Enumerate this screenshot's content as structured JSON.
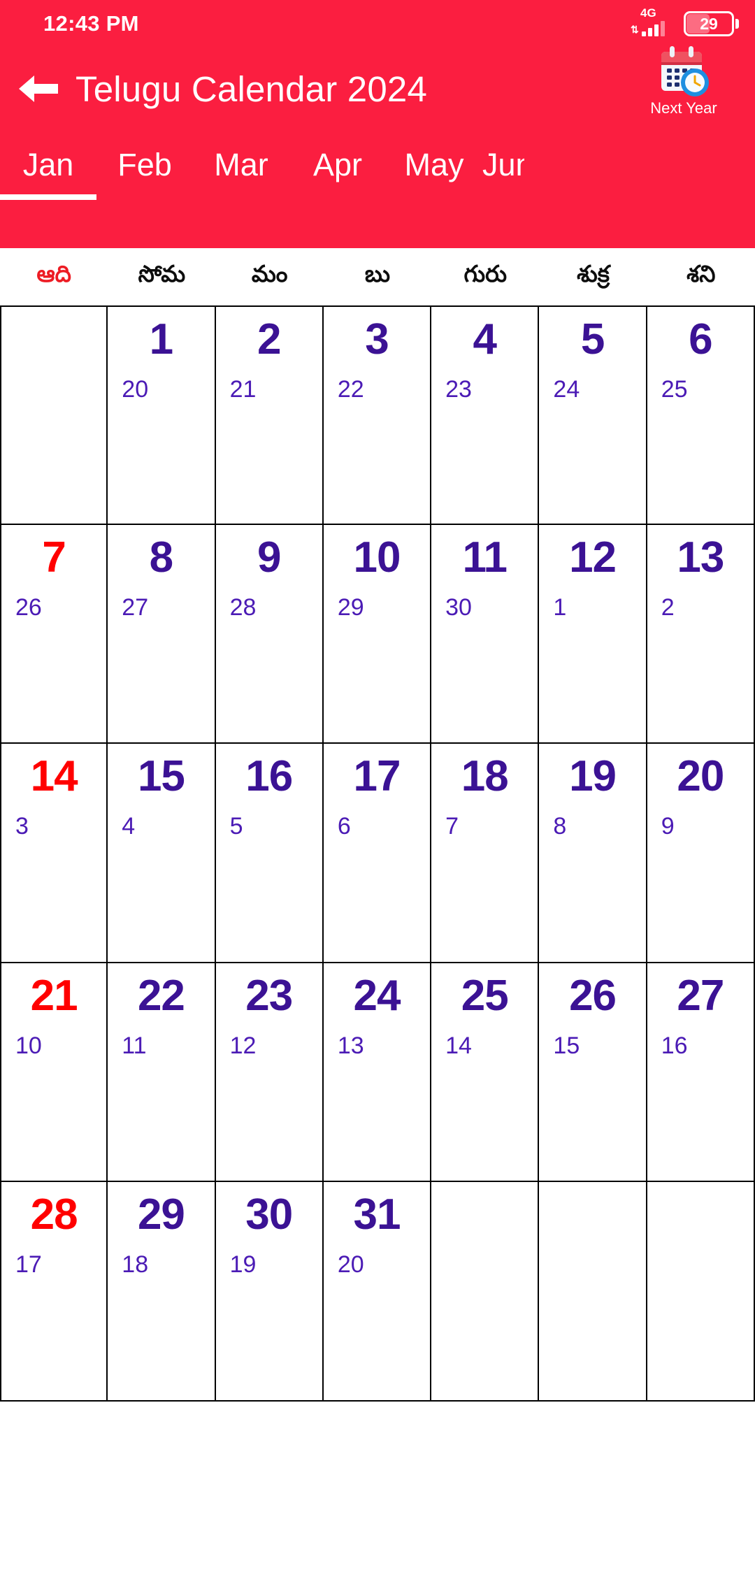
{
  "statusbar": {
    "time": "12:43 PM",
    "network_type": "4G",
    "battery_percent": "29",
    "signal_icon": "signal-bars-icon",
    "data_arrows_icon": "data-transfer-icon",
    "battery_icon": "battery-icon"
  },
  "appbar": {
    "back_icon": "back-arrow-icon",
    "title": "Telugu Calendar 2024",
    "next_year_label": "Next Year",
    "next_year_icon": "calendar-clock-icon",
    "background_color": "#FB1E40"
  },
  "tabs": {
    "selected_index": 0,
    "items": [
      {
        "label": "Jan"
      },
      {
        "label": "Feb"
      },
      {
        "label": "Mar"
      },
      {
        "label": "Apr"
      },
      {
        "label": "May"
      },
      {
        "label": "Jun"
      }
    ]
  },
  "weekdays": [
    {
      "label": "ఆది",
      "is_sunday": true
    },
    {
      "label": "సోమ",
      "is_sunday": false
    },
    {
      "label": "మం",
      "is_sunday": false
    },
    {
      "label": "బు",
      "is_sunday": false
    },
    {
      "label": "గురు",
      "is_sunday": false
    },
    {
      "label": "శుక్ర",
      "is_sunday": false
    },
    {
      "label": "శని",
      "is_sunday": false
    }
  ],
  "calendar": {
    "accent_color": "#FB1E40",
    "day_color": "#3B1294",
    "sunday_color": "#FF0000",
    "sub_color": "#4B1BB5",
    "weeks": [
      [
        {
          "day": "",
          "sub": "",
          "empty": true
        },
        {
          "day": "1",
          "sub": "20",
          "empty": false
        },
        {
          "day": "2",
          "sub": "21",
          "empty": false
        },
        {
          "day": "3",
          "sub": "22",
          "empty": false
        },
        {
          "day": "4",
          "sub": "23",
          "empty": false
        },
        {
          "day": "5",
          "sub": "24",
          "empty": false
        },
        {
          "day": "6",
          "sub": "25",
          "empty": false
        }
      ],
      [
        {
          "day": "7",
          "sub": "26",
          "empty": false
        },
        {
          "day": "8",
          "sub": "27",
          "empty": false
        },
        {
          "day": "9",
          "sub": "28",
          "empty": false
        },
        {
          "day": "10",
          "sub": "29",
          "empty": false
        },
        {
          "day": "11",
          "sub": "30",
          "empty": false
        },
        {
          "day": "12",
          "sub": "1",
          "empty": false
        },
        {
          "day": "13",
          "sub": "2",
          "empty": false
        }
      ],
      [
        {
          "day": "14",
          "sub": "3",
          "empty": false
        },
        {
          "day": "15",
          "sub": "4",
          "empty": false
        },
        {
          "day": "16",
          "sub": "5",
          "empty": false
        },
        {
          "day": "17",
          "sub": "6",
          "empty": false
        },
        {
          "day": "18",
          "sub": "7",
          "empty": false
        },
        {
          "day": "19",
          "sub": "8",
          "empty": false
        },
        {
          "day": "20",
          "sub": "9",
          "empty": false
        }
      ],
      [
        {
          "day": "21",
          "sub": "10",
          "empty": false
        },
        {
          "day": "22",
          "sub": "11",
          "empty": false
        },
        {
          "day": "23",
          "sub": "12",
          "empty": false
        },
        {
          "day": "24",
          "sub": "13",
          "empty": false
        },
        {
          "day": "25",
          "sub": "14",
          "empty": false
        },
        {
          "day": "26",
          "sub": "15",
          "empty": false
        },
        {
          "day": "27",
          "sub": "16",
          "empty": false
        }
      ],
      [
        {
          "day": "28",
          "sub": "17",
          "empty": false
        },
        {
          "day": "29",
          "sub": "18",
          "empty": false
        },
        {
          "day": "30",
          "sub": "19",
          "empty": false
        },
        {
          "day": "31",
          "sub": "20",
          "empty": false
        },
        {
          "day": "",
          "sub": "",
          "empty": true
        },
        {
          "day": "",
          "sub": "",
          "empty": true
        },
        {
          "day": "",
          "sub": "",
          "empty": true
        }
      ]
    ]
  }
}
